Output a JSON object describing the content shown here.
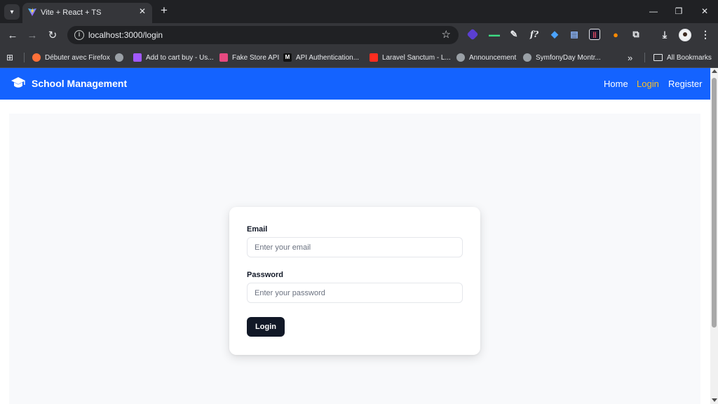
{
  "browser": {
    "tab": {
      "title": "Vite + React + TS",
      "close_glyph": "✕"
    },
    "new_tab_glyph": "+",
    "window": {
      "minimize": "—",
      "restore": "❐",
      "close": "✕"
    },
    "url": "localhost:3000/login",
    "bookmarks": [
      {
        "label": "Débuter avec Firefox",
        "icon_color": "#ff7139"
      },
      {
        "label": "",
        "icon_color": "#9aa0a6"
      },
      {
        "label": "Add to cart buy - Us...",
        "icon_color": "#a259ff"
      },
      {
        "label": "Fake Store API",
        "icon_color": "#e64980"
      },
      {
        "label": "API Authentication...",
        "icon_color": "#f1f3f4"
      },
      {
        "label": "Laravel Sanctum - L...",
        "icon_color": "#ff2d20"
      },
      {
        "label": "Announcement",
        "icon_color": "#9aa0a6"
      },
      {
        "label": "SymfonyDay Montr...",
        "icon_color": "#9aa0a6"
      }
    ],
    "bookmarks_overflow": "»",
    "all_bookmarks": "All Bookmarks"
  },
  "app": {
    "brand": "School Management",
    "nav": {
      "home": "Home",
      "login": "Login",
      "register": "Register"
    },
    "form": {
      "email_label": "Email",
      "email_placeholder": "Enter your email",
      "email_value": "",
      "password_label": "Password",
      "password_placeholder": "Enter your password",
      "password_value": "",
      "submit": "Login"
    }
  },
  "colors": {
    "navbar": "#1463ff",
    "active_link": "#fbbf24",
    "button": "#111827"
  }
}
